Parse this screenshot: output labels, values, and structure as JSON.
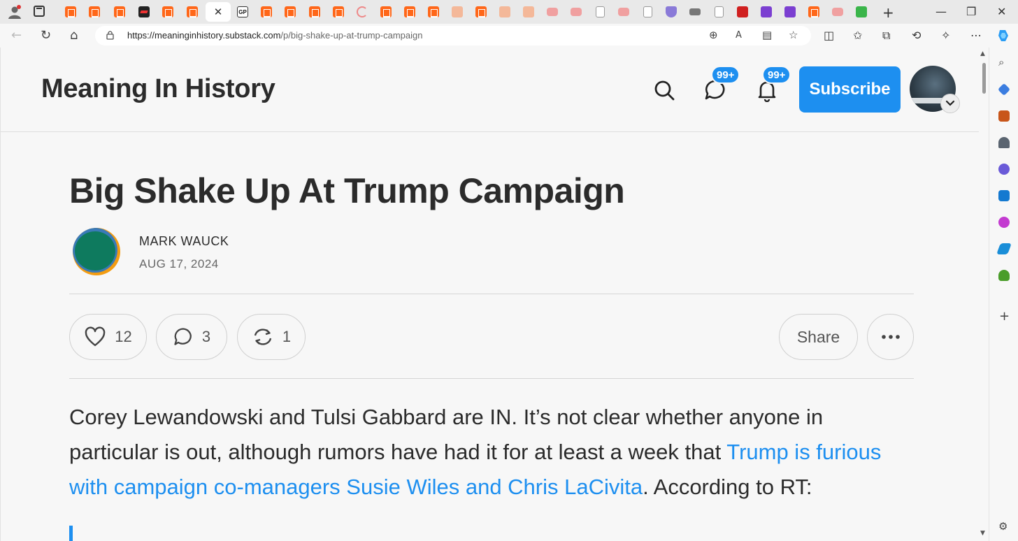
{
  "browser": {
    "active_tab_favicon": "GP",
    "url_host": "https://meaninginhistory.substack.com",
    "url_path": "/p/big-shake-up-at-trump-campaign",
    "new_tab_label": "+",
    "tab_close": "✕"
  },
  "site": {
    "title": "Meaning In History",
    "chat_badge": "99+",
    "notif_badge": "99+",
    "subscribe_label": "Subscribe"
  },
  "post": {
    "title": "Big Shake Up At Trump Campaign",
    "author": "MARK WAUCK",
    "date": "AUG 17, 2024",
    "likes": "12",
    "comments": "3",
    "restacks": "1",
    "share_label": "Share",
    "para_start": "Corey Lewandowski and Tulsi Gabbard are IN. It’s not clear whether anyone in particular is out, although rumors have had it for at least a week that ",
    "para_link": "Trump is furious with campaign co-managers Susie Wiles and Chris LaCivita",
    "para_end": ". According to RT:"
  },
  "colors": {
    "accent": "#1d8ff0",
    "substack_orange": "#ff6719"
  },
  "icons": [
    "profile-icon",
    "tab-actions-icon",
    "back-icon",
    "refresh-icon",
    "home-icon",
    "lock-icon",
    "zoom-icon",
    "read-aloud-icon",
    "immersive-reader-icon",
    "favorite-icon",
    "split-screen-icon",
    "favorites-icon",
    "collections-icon",
    "history-icon",
    "extensions-icon",
    "more-icon",
    "copilot-icon",
    "search-icon",
    "chat-icon",
    "bell-icon",
    "heart-icon",
    "comment-icon",
    "restack-icon",
    "ellipsis-icon"
  ]
}
